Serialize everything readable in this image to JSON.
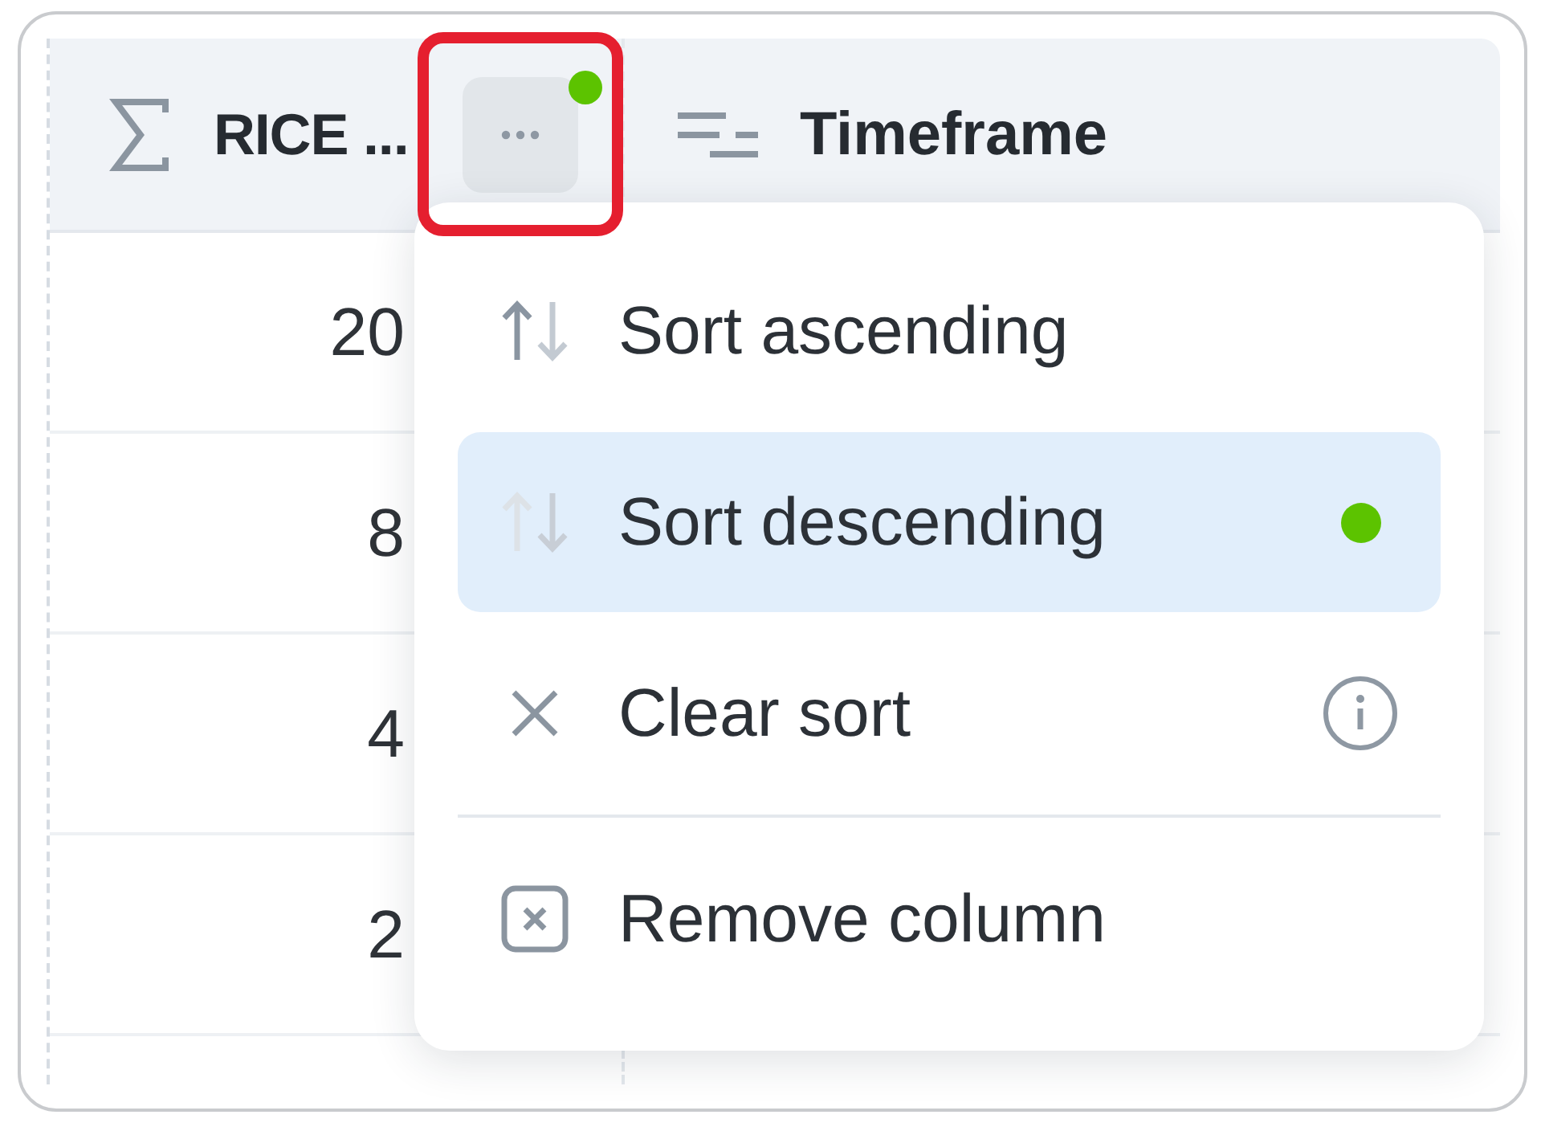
{
  "table": {
    "columns": [
      {
        "kind": "formula",
        "label": "RICE ...",
        "menu_button": {
          "highlighted": true,
          "indicator": true
        }
      },
      {
        "kind": "text",
        "label": "Timeframe"
      }
    ],
    "rows": [
      {
        "column_1": "20"
      },
      {
        "column_1": "8"
      },
      {
        "column_1": "4"
      },
      {
        "column_1": "2"
      }
    ]
  },
  "column_menu": {
    "sections": [
      {
        "items": [
          {
            "kind": "sort_ascending",
            "label": "Sort ascending",
            "selected": false,
            "info": false
          },
          {
            "kind": "sort_descending",
            "label": "Sort descending",
            "selected": true,
            "info": false
          },
          {
            "kind": "clear_sort",
            "label": "Clear sort",
            "selected": false,
            "info": true
          }
        ]
      },
      {
        "items": [
          {
            "kind": "remove_column",
            "label": "Remove column",
            "selected": false,
            "info": false
          }
        ]
      }
    ]
  }
}
